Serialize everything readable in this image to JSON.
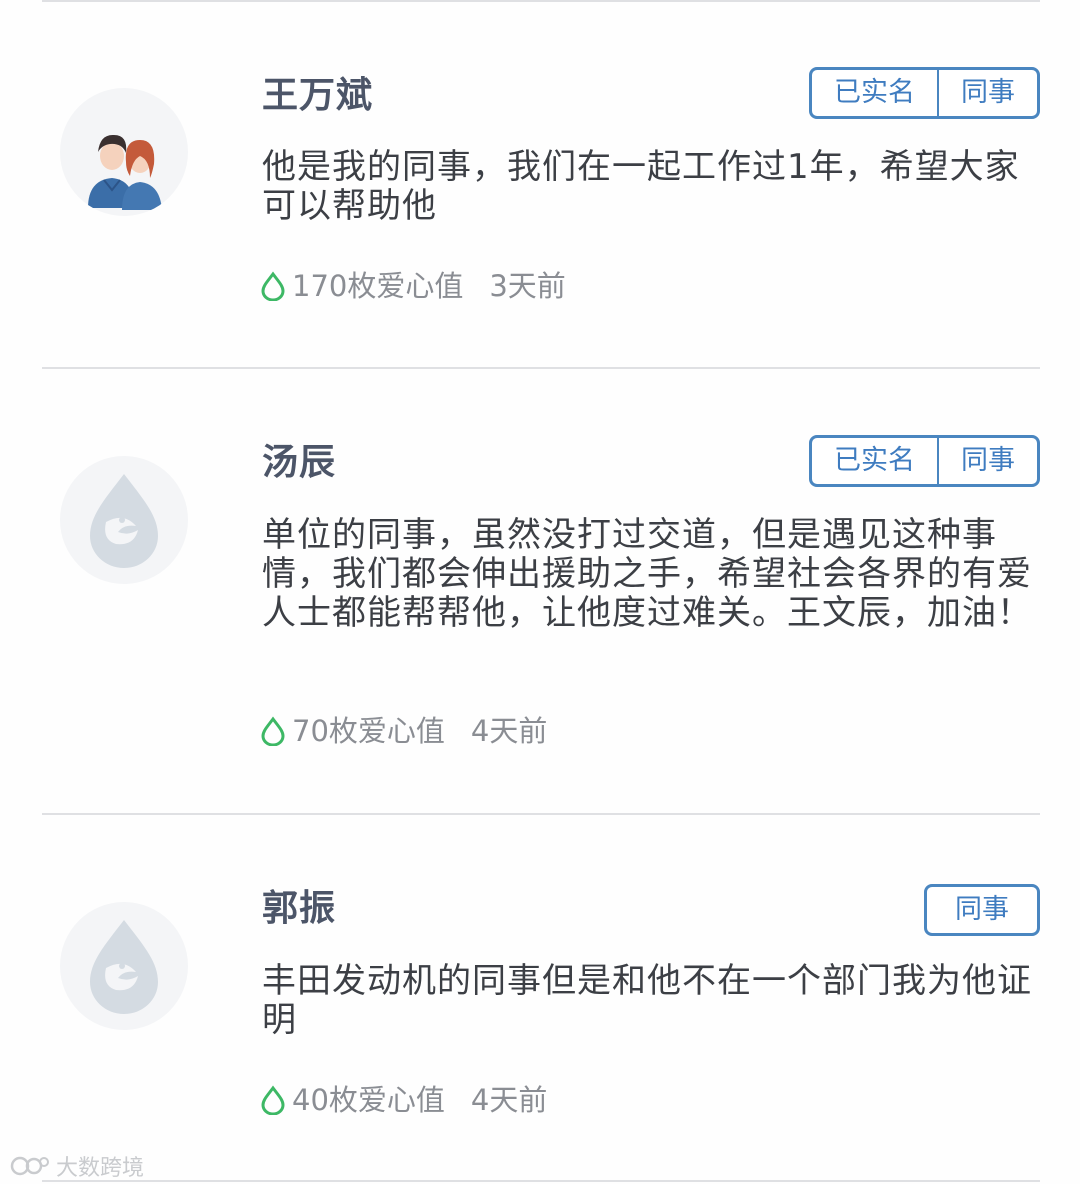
{
  "comments": [
    {
      "name": "王万斌",
      "tags": [
        "已实名",
        "同事"
      ],
      "message": "他是我的同事，我们在一起工作过1年，希望大家可以帮助他",
      "love_points": "170枚爱心值",
      "time": "3天前",
      "avatar": "couple-illustration"
    },
    {
      "name": "汤辰",
      "tags": [
        "已实名",
        "同事"
      ],
      "message": "单位的同事，虽然没打过交道，但是遇见这种事情，我们都会伸出援助之手，希望社会各界的有爱人士都能帮帮他，让他度过难关。王文辰，加油！",
      "love_points": "70枚爱心值",
      "time": "4天前",
      "avatar": "default-drop-avatar"
    },
    {
      "name": "郭振",
      "tags": [
        "同事"
      ],
      "message": "丰田发动机的同事但是和他不在一个部门我为他证明",
      "love_points": "40枚爱心值",
      "time": "4天前",
      "avatar": "default-drop-avatar"
    }
  ],
  "watermark": "大数跨境",
  "colors": {
    "tag_border": "#4a86c0",
    "tag_text": "#3f7cc0",
    "name": "#4c5568",
    "love_icon": "#3db865"
  }
}
